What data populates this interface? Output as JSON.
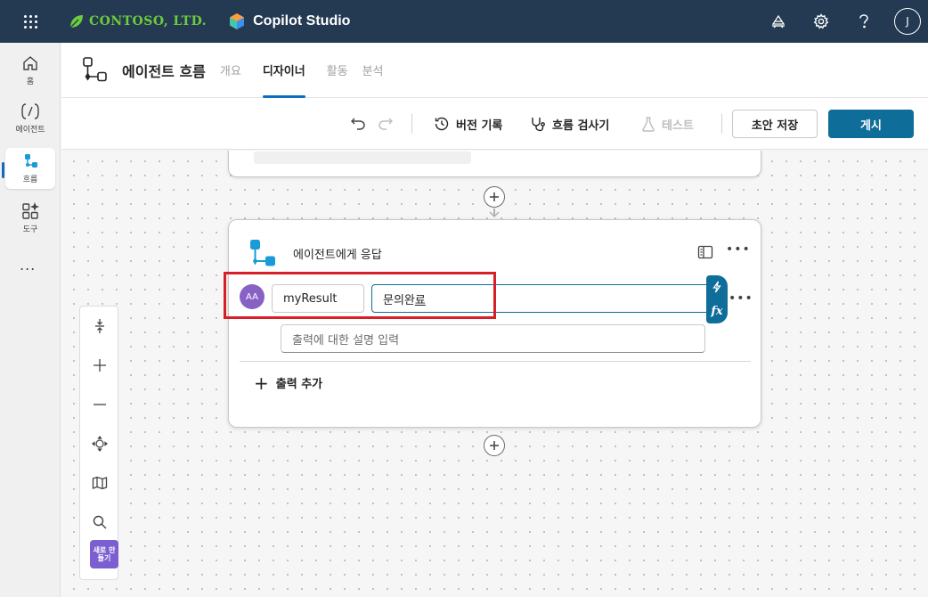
{
  "topbar": {
    "brand_name": "CONTOSO, LTD.",
    "product_name": "Copilot Studio",
    "avatar_initial": "J",
    "colors": {
      "bar": "#233a52",
      "brand": "#6ecb3b"
    }
  },
  "rail": {
    "items": [
      {
        "label": "홈",
        "icon": "home-icon"
      },
      {
        "label": "에이전트",
        "icon": "agent-icon"
      },
      {
        "label": "흐름",
        "icon": "flow-icon"
      },
      {
        "label": "도구",
        "icon": "tools-icon"
      }
    ],
    "more": "..."
  },
  "header": {
    "title": "에이전트 흐름",
    "tabs": [
      {
        "label": "개요",
        "active": false
      },
      {
        "label": "디자이너",
        "active": true
      },
      {
        "label": "활동",
        "active": false
      },
      {
        "label": "분석",
        "active": false
      }
    ]
  },
  "toolbar": {
    "version_history": "버전 기록",
    "flow_checker": "흐름 검사기",
    "test": "테스트",
    "save_draft": "초안 저장",
    "publish": "게시",
    "colors": {
      "publish": "#0f6d9a"
    }
  },
  "card": {
    "title": "에이전트에게 응답",
    "output_name": "myResult",
    "output_value": "문의완료",
    "output_value_main": "문의완",
    "output_value_last": "료",
    "avatar_text": "AA",
    "fx_label": "fx",
    "description_placeholder": "출력에 대한 설명 입력",
    "add_output": "출력 추가"
  },
  "zoom": {
    "new_label": "새로 만들기"
  }
}
